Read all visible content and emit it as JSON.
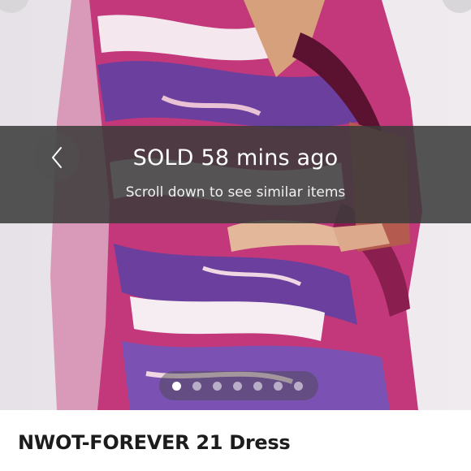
{
  "listing": {
    "status_title": "SOLD 58 mins ago",
    "status_subtitle": "Scroll down to see similar items",
    "item_title": "NWOT-FOREVER 21 Dress"
  },
  "carousel": {
    "image_count": 7,
    "active_index": 0,
    "prev_icon": "chevron-left-icon"
  },
  "colors": {
    "overlay": "#3a3a3a",
    "dress_pink": "#c2387a",
    "dress_purple": "#6a3f9e",
    "dress_white": "#f4e7ee",
    "dress_dark": "#5a1230"
  }
}
